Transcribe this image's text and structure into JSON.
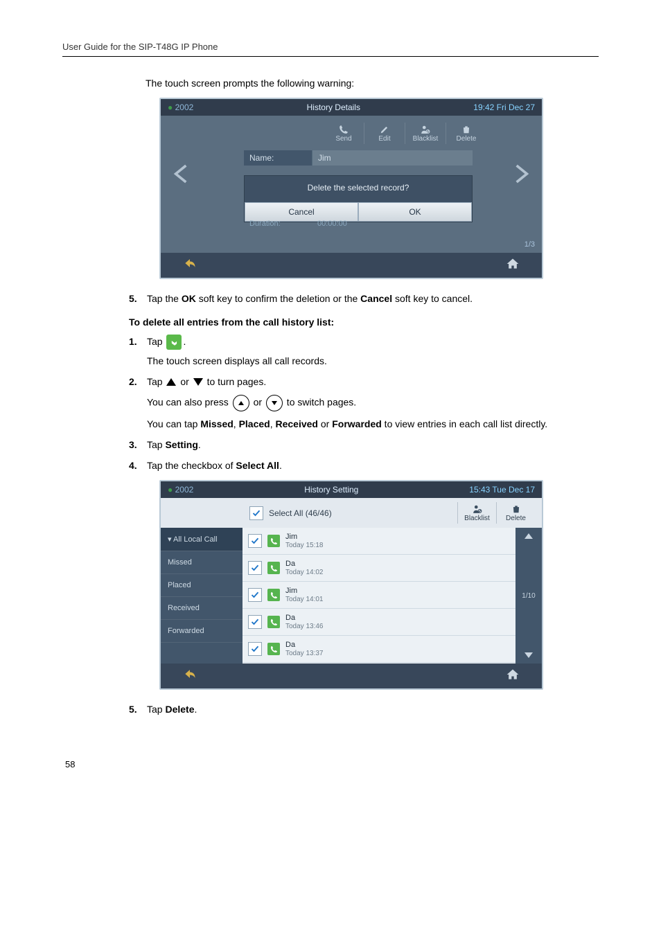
{
  "header": "User Guide for the SIP-T48G IP Phone",
  "page_number": "58",
  "text": {
    "prompt_line": "The touch screen prompts the following warning:",
    "step5_prefix": "Tap the ",
    "ok_key": "OK",
    "step5_mid": " soft key to confirm the deletion or the ",
    "cancel_key": "Cancel",
    "step5_suffix": " soft key to cancel.",
    "section2": "To delete all entries from the call history list:",
    "s2_step1_a": "Tap ",
    "s2_step1_b": ".",
    "s2_step1_sub": "The touch screen displays all call records.",
    "s2_step2_a": "Tap ",
    "s2_step2_b": " or ",
    "s2_step2_c": " to turn pages.",
    "s2_step2_sub1_a": "You can also press ",
    "s2_step2_sub1_b": " or ",
    "s2_step2_sub1_c": "  to switch pages.",
    "s2_step2_sub2_a": "You can tap ",
    "missed": "Missed",
    "comma1": ", ",
    "placed": "Placed",
    "comma2": ", ",
    "received": "Received",
    "or": " or ",
    "forwarded": "Forwarded",
    "s2_step2_sub2_b": " to view entries in each call list directly.",
    "s2_step3_a": "Tap ",
    "setting": "Setting",
    "period": ".",
    "s2_step4_a": "Tap the checkbox of ",
    "selectall": "Select All",
    "s2_step5_a": "Tap ",
    "delete": "Delete",
    "n1": "1.",
    "n2": "2.",
    "n3": "3.",
    "n4": "4.",
    "n5": "5."
  },
  "screenshot1": {
    "ext_left": "2002",
    "title": "History Details",
    "datetime": "19:42 Fri Dec 27",
    "actions": {
      "send": "Send",
      "edit": "Edit",
      "blacklist": "Blacklist",
      "delete": "Delete"
    },
    "field_name_label": "Name:",
    "field_name_value": "Jim",
    "dialog_text": "Delete the selected record?",
    "btn_cancel": "Cancel",
    "btn_ok": "OK",
    "duration_label": "Duration:",
    "duration_value": "00:00:00",
    "pager": "1/3"
  },
  "screenshot2": {
    "ext_left": "2002",
    "title": "History Setting",
    "datetime": "15:43 Tue Dec 17",
    "select_all": "Select All (46/46)",
    "actions": {
      "blacklist": "Blacklist",
      "delete": "Delete"
    },
    "sidebar": [
      "All Local Call",
      "Missed",
      "Placed",
      "Received",
      "Forwarded"
    ],
    "rows": [
      {
        "name": "Jim",
        "time": "Today 15:18"
      },
      {
        "name": "Da",
        "time": "Today 14:02"
      },
      {
        "name": "Jim",
        "time": "Today 14:01"
      },
      {
        "name": "Da",
        "time": "Today 13:46"
      },
      {
        "name": "Da",
        "time": "Today 13:37"
      }
    ],
    "pager": "1/10"
  }
}
